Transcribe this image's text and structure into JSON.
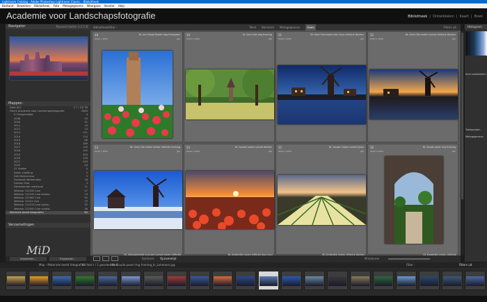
{
  "window": {
    "title": "Lightroom Catalog - Adobe Photoshop Lightroom Classic - Bibliotheek"
  },
  "menu": [
    "Bestand",
    "Bewerken",
    "Bibliotheek",
    "Foto",
    "Metagegevens",
    "Weergave",
    "Venster",
    "Help"
  ],
  "identity_plate": "Academie voor Landschapsfotografie",
  "modules": {
    "active": "Bibliotheek",
    "others": [
      "Ontwikkelen",
      "Kaart",
      "Boek"
    ]
  },
  "left_panel": {
    "navigator_label": "Navigator",
    "navigator_zoom": "Passend  Vullen  1:1  1:8",
    "catalog_label": "Mappen",
    "volume": {
      "name": "Data (D:)",
      "info": "1,7 / 3,6 TB"
    },
    "folders": [
      {
        "name": "Foto's Academie voor Landschapsfotografie",
        "count": "2584",
        "level": 0
      },
      {
        "name": "0 Cinegenstijke",
        "count": "4",
        "level": 1
      },
      {
        "name": "2008",
        "count": "29",
        "level": 1
      },
      {
        "name": "2009",
        "count": "31",
        "level": 1
      },
      {
        "name": "2011",
        "count": "13",
        "level": 1
      },
      {
        "name": "2012",
        "count": "13",
        "level": 1
      },
      {
        "name": "2013",
        "count": "121",
        "level": 1
      },
      {
        "name": "2014",
        "count": "110",
        "level": 1
      },
      {
        "name": "2015",
        "count": "66",
        "level": 1
      },
      {
        "name": "2016",
        "count": "189",
        "level": 1
      },
      {
        "name": "2017",
        "count": "190",
        "level": 1
      },
      {
        "name": "2018",
        "count": "192",
        "level": 1
      },
      {
        "name": "2019",
        "count": "303",
        "level": 1
      },
      {
        "name": "2020",
        "count": "133",
        "level": 1
      },
      {
        "name": "2021",
        "count": "249",
        "level": 1
      },
      {
        "name": "2022",
        "count": "44",
        "level": 1
      },
      {
        "name": "22 Illuster",
        "count": "0",
        "level": 1
      },
      {
        "name": "Edisic inleiding",
        "count": "3",
        "level": 1
      },
      {
        "name": "Edit Masterclass",
        "count": "3",
        "level": 1
      },
      {
        "name": "Facebook Wedstrijden",
        "count": "18",
        "level": 1
      },
      {
        "name": "Fontain Foto",
        "count": "3",
        "level": 1
      },
      {
        "name": "Fotokalender materiaal",
        "count": "11",
        "level": 1
      },
      {
        "name": "Webinar 121020 Live",
        "count": "27",
        "level": 1
      },
      {
        "name": "Webinar 121020 Live advanc",
        "count": "13",
        "level": 1
      },
      {
        "name": "Webinar 121067 Live",
        "count": "52",
        "level": 1
      },
      {
        "name": "Webinar 12101 Live",
        "count": "19",
        "level": 1
      },
      {
        "name": "Webinar 121013 Live vakan..",
        "count": "32",
        "level": 1
      },
      {
        "name": "Webinar 121000 Live voorbs..",
        "count": "36",
        "level": 1
      },
      {
        "name": "Materiele beeld fotografien",
        "count": "64",
        "level": 0
      }
    ],
    "collections_label": "Verzamelingen",
    "signature": "MiD",
    "buttons": [
      "Importeren...",
      "Exporteren..."
    ]
  },
  "toolbar_top": {
    "breadcrumb": "Bibliotheekfilter :",
    "filters": [
      "Tekst",
      "Kenmerk",
      "Metagegevens",
      "Geen"
    ],
    "active_filter": "Geen",
    "right": "Filters uit"
  },
  "grid_cells": [
    {
      "num": "48",
      "info": "NL Anti Hoag Balpen dag Evergreen",
      "dims": "6000 x 4000",
      "ext": "JPG"
    },
    {
      "num": "50",
      "info": "NL Gent Olst dag Evening",
      "dims": "6000 x 4000",
      "ext": "JPG"
    },
    {
      "num": "51",
      "info": "NL Gent Olst molen blau hour reflectie Decken",
      "dims": "6000 x 4000",
      "ext": "JPG"
    },
    {
      "num": "52",
      "info": "NL Gent Olst molen sunset reflectie Decken",
      "dims": "6000 x 4000",
      "ext": "JPG"
    },
    {
      "num": "53",
      "info": "NL Gent Olst molen winter reflectie framing",
      "dims": "6000 x 4000",
      "ext": "JPG"
    },
    {
      "num": "54",
      "info": "NL Gouwe tulpen sunset decken",
      "dims": "6000 x 4000",
      "ext": "JPG"
    },
    {
      "num": "55",
      "info": "NL Gouwe tulpen sunset lijnen",
      "dims": "6000 x 4000",
      "ext": "JPG"
    },
    {
      "num": "56",
      "info": "NL Gouda poort ring framing",
      "dims": "4000 x 6000",
      "ext": "JPG"
    }
  ],
  "grid_bottom_labels": [
    "NL Gelloubehelde oud-oed sunset molen reflectie",
    "NL Kinderdijk molen reflectie blau hour",
    "NL Kinderdijk molen reflectie Decken",
    "NL Kinderdijk molen reflectie"
  ],
  "grid_toolbar": {
    "sort_label": "Sorteren:",
    "sort_value": "Opnametijd",
    "thumbnails_label": "Miniaturen"
  },
  "right_panel": {
    "histogram_label": "Histogram",
    "quick_develop": "Snel ontwikkelen",
    "keywords": "Trefwoorden",
    "metadata": "Metagegevens"
  },
  "filmstrip_bar": {
    "source": "Map : Materiele beeld fotografien",
    "count": "64 foto's / 1 geselecteerd",
    "file": "/ NL Gouda poort ring framing_ki_Lehmann.jpg",
    "filter": "Filter :",
    "filter_value": "Filters uit"
  },
  "filmstrip": {
    "selected_index": 11,
    "count": 21
  }
}
